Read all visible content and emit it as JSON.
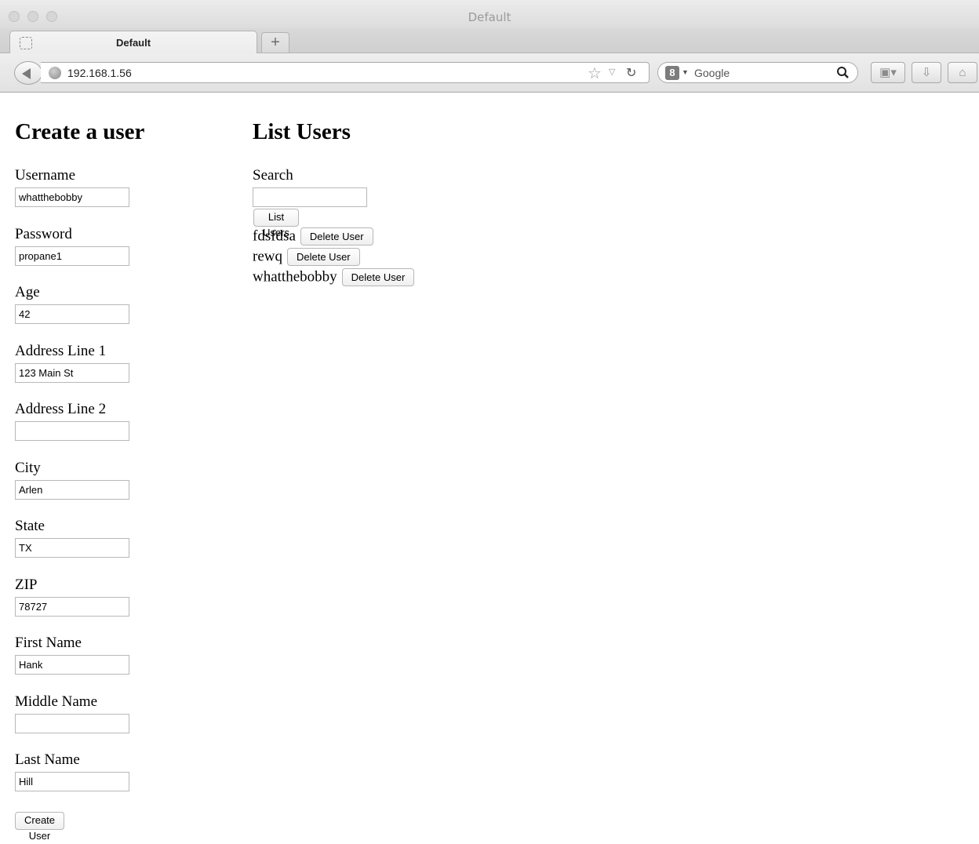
{
  "window": {
    "title": "Default",
    "tab_title": "Default",
    "new_tab_symbol": "+"
  },
  "toolbar": {
    "url": "192.168.1.56",
    "search_engine_badge": "8",
    "search_placeholder": "Google"
  },
  "create_user": {
    "heading": "Create a user",
    "fields": [
      {
        "label": "Username",
        "value": "whatthebobby"
      },
      {
        "label": "Password",
        "value": "propane1"
      },
      {
        "label": "Age",
        "value": "42"
      },
      {
        "label": "Address Line 1",
        "value": "123 Main St"
      },
      {
        "label": "Address Line 2",
        "value": ""
      },
      {
        "label": "City",
        "value": "Arlen"
      },
      {
        "label": "State",
        "value": "TX"
      },
      {
        "label": "ZIP",
        "value": "78727"
      },
      {
        "label": "First Name",
        "value": "Hank"
      },
      {
        "label": "Middle Name",
        "value": ""
      },
      {
        "label": "Last Name",
        "value": "Hill"
      }
    ],
    "submit_label": "Create User"
  },
  "list_users": {
    "heading": "List Users",
    "search_label": "Search",
    "search_value": "",
    "list_button_label": "List Users",
    "delete_button_label": "Delete User",
    "users": [
      "fdsfdsa",
      "rewq",
      "whatthebobby"
    ]
  }
}
